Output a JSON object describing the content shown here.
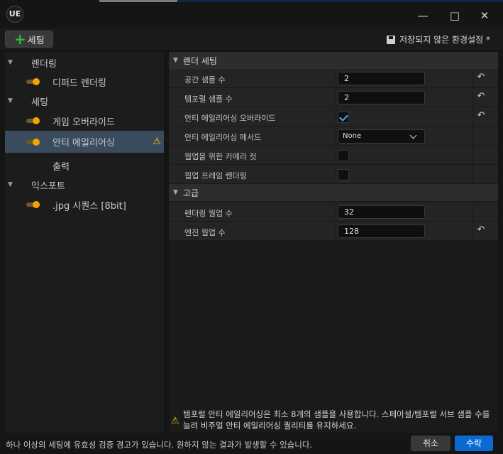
{
  "window": {
    "logo": "UE",
    "minimize_icon": "minimize-icon",
    "maximize_icon": "maximize-icon",
    "close_icon": "close-icon"
  },
  "toolbar": {
    "settings_label": "세팅",
    "unsaved_label": "저장되지 않은 환경설정 *",
    "unsaved_icon": "save-icon"
  },
  "sidebar": {
    "groups": [
      {
        "label": "렌더링",
        "items": [
          {
            "label": "디퍼드 렌더링",
            "toggle": true
          }
        ]
      },
      {
        "label": "세팅",
        "items": [
          {
            "label": "게임 오버라이드",
            "toggle": true
          },
          {
            "label": "안티 에일리어싱",
            "toggle": true,
            "selected": true,
            "warning": true
          },
          {
            "label": "출력",
            "toggle": false
          }
        ]
      },
      {
        "label": "익스포트",
        "items": [
          {
            "label": ".jpg 시퀀스 [8bit]",
            "toggle": true
          }
        ]
      }
    ]
  },
  "details": {
    "section1": {
      "title": "렌더 세팅",
      "rows": [
        {
          "label": "공간 샘플 수",
          "value": "2"
        },
        {
          "label": "템포럴 샘플 수",
          "value": "2"
        },
        {
          "label": "안티 에일리어싱 오버라이드",
          "checked": true
        },
        {
          "label": "안티 에일리어싱 메서드",
          "value": "None"
        },
        {
          "label": "웜업을 위한 카메라 컷",
          "checked": false
        },
        {
          "label": "웜업 프레임 렌더링",
          "checked": false
        }
      ]
    },
    "section2": {
      "title": "고급",
      "rows": [
        {
          "label": "렌더링 웜업 수",
          "value": "32"
        },
        {
          "label": "엔진 웜업 수",
          "value": "128"
        }
      ]
    }
  },
  "notice": {
    "text": "템포럴 안티 에일리어싱은 최소 8개의 샘플을 사용합니다. 스페이셜/템포럴 서브 샘플 수를 늘려 비주얼 안티 에일리어싱 퀄리티를 유지하세요."
  },
  "status": {
    "text": "하나 이상의 세팅에 유효성 검증 경고가 있습니다. 원하지 않는 결과가 발생할 수 있습니다.",
    "cancel": "취소",
    "accept": "수락"
  },
  "colors": {
    "accent": "#0a6ad2",
    "selection": "#3a4b5e",
    "toggle_on": "#f0a500",
    "warning": "#f2d400"
  }
}
